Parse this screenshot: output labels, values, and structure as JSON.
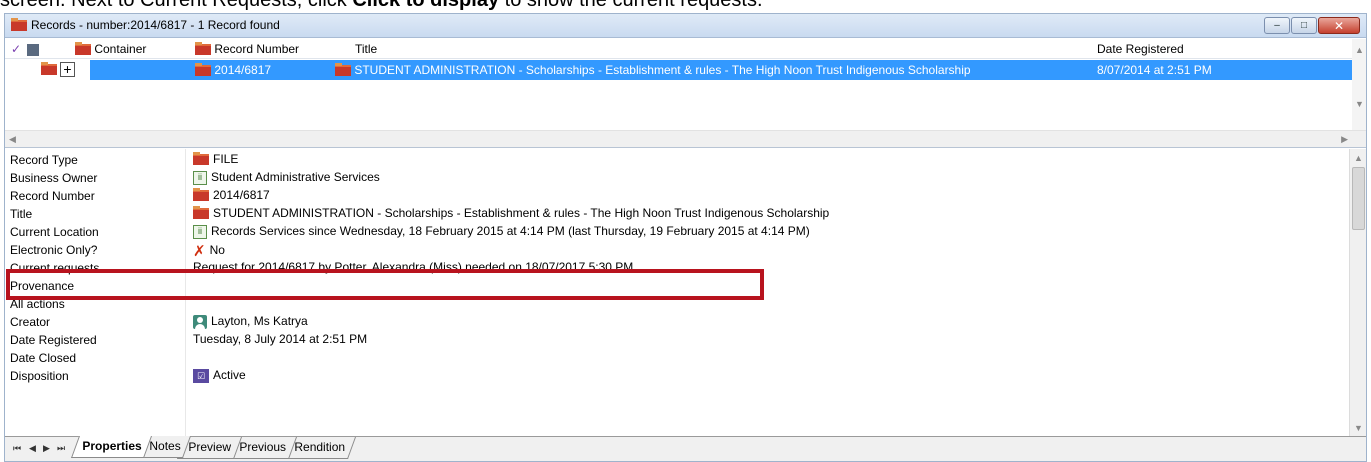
{
  "instruction": {
    "prefix": "screen. Next to Current Requests, click ",
    "bold": "Click to display",
    "suffix": " to show the current requests."
  },
  "window": {
    "title": "Records - number:2014/6817 - 1 Record found",
    "buttons": {
      "minimize": "–",
      "maximize": "□",
      "close": "✕"
    }
  },
  "list": {
    "columns": {
      "check": "✓",
      "container": "Container",
      "record_number": "Record Number",
      "title": "Title",
      "date_registered": "Date Registered"
    },
    "rows": [
      {
        "expander": "+",
        "record_number": "2014/6817",
        "title": "STUDENT ADMINISTRATION - Scholarships - Establishment & rules - The High Noon Trust Indigenous Scholarship",
        "date_registered": "8/07/2014 at 2:51 PM"
      }
    ]
  },
  "properties": [
    {
      "label": "Record Type",
      "icon": "folder-icon",
      "value": "FILE"
    },
    {
      "label": "Business Owner",
      "icon": "org-unit-icon",
      "value": "Student Administrative Services"
    },
    {
      "label": "Record Number",
      "icon": "folder-icon",
      "value": "2014/6817"
    },
    {
      "label": "Title",
      "icon": "folder-icon",
      "value": "STUDENT ADMINISTRATION - Scholarships - Establishment & rules - The High Noon Trust Indigenous Scholarship"
    },
    {
      "label": "Current Location",
      "icon": "org-unit-icon",
      "value": "Records Services since Wednesday, 18 February 2015 at 4:14 PM (last Thursday, 19 February 2015 at 4:14 PM)"
    },
    {
      "label": "Electronic Only?",
      "icon": "x-icon",
      "value": "No"
    },
    {
      "label": "Current requests",
      "icon": "",
      "value": "Request for 2014/6817 by Potter, Alexandra (Miss) needed on 18/07/2017 5:30 PM"
    },
    {
      "label": "Provenance",
      "icon": "",
      "value": ""
    },
    {
      "label": "All actions",
      "icon": "",
      "value": ""
    },
    {
      "label": "Creator",
      "icon": "person-icon",
      "value": "Layton, Ms Katrya"
    },
    {
      "label": "Date Registered",
      "icon": "",
      "value": "Tuesday, 8 July 2014 at 2:51 PM"
    },
    {
      "label": "Date Closed",
      "icon": "",
      "value": ""
    },
    {
      "label": "Disposition",
      "icon": "disposition-icon",
      "value": "Active"
    }
  ],
  "tabs": {
    "nav": [
      "⏮",
      "◀",
      "▶",
      "⏭"
    ],
    "items": [
      "Properties",
      "Notes",
      "Preview",
      "Previous",
      "Rendition"
    ],
    "active": "Properties"
  },
  "colors": {
    "selection": "#3399ff",
    "highlight_box": "#b8131e",
    "folder": "#c8382a"
  }
}
